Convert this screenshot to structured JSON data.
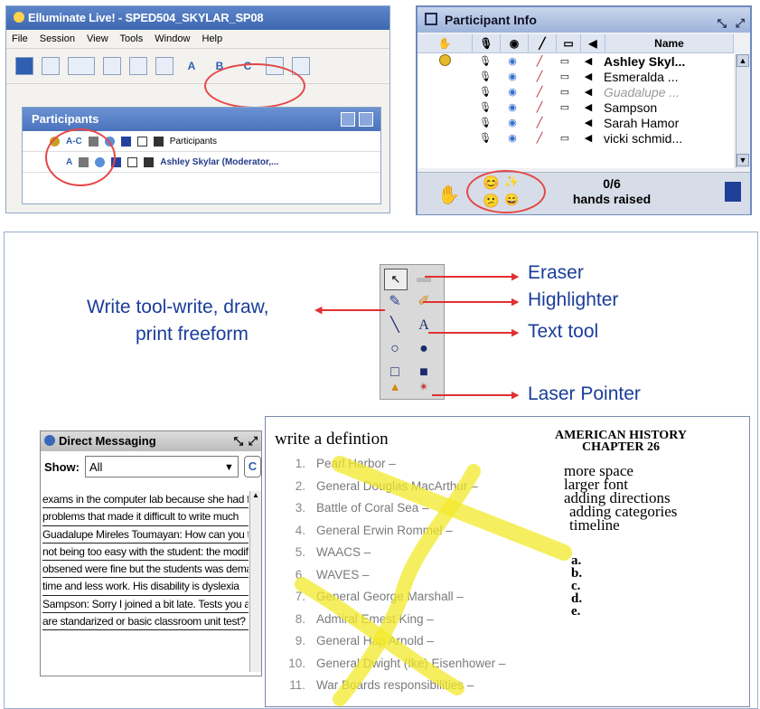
{
  "elluminate": {
    "title": "Elluminate Live! - SPED504_SKYLAR_SP08",
    "menu": [
      "File",
      "Session",
      "View",
      "Tools",
      "Window",
      "Help"
    ],
    "toolbar_letters": [
      "A",
      "B",
      "C"
    ]
  },
  "participants": {
    "title": "Participants",
    "header_label": "Participants",
    "row_name": "Ashley Skylar (Moderator,...",
    "ac_label": "A-C",
    "a_label": "A"
  },
  "participant_info": {
    "title": "Participant Info",
    "name_header": "Name",
    "rows": [
      {
        "name": "Ashley Skyl...",
        "style": "bold",
        "icons": [
          true,
          true,
          true,
          true
        ]
      },
      {
        "name": "Esmeralda ...",
        "style": "normal",
        "icons": [
          true,
          true,
          true,
          true
        ]
      },
      {
        "name": "Guadalupe ...",
        "style": "italic",
        "icons": [
          true,
          true,
          true,
          true
        ]
      },
      {
        "name": "Sampson",
        "style": "normal",
        "icons": [
          true,
          true,
          true,
          true
        ]
      },
      {
        "name": "Sarah Hamor",
        "style": "normal",
        "icons": [
          true,
          true,
          true,
          false
        ]
      },
      {
        "name": "vicki schmid...",
        "style": "normal",
        "icons": [
          true,
          true,
          true,
          true
        ]
      }
    ],
    "hands_count": "0/6",
    "hands_label": "hands raised"
  },
  "tools_legend": {
    "write_tool_label": "Write tool-write, draw,",
    "write_tool_label2": "print freeform",
    "eraser": "Eraser",
    "highlighter": "Highlighter",
    "text_tool": "Text tool",
    "laser_pointer": "Laser Pointer",
    "text_glyph": "A"
  },
  "direct_messaging": {
    "title": "Direct Messaging",
    "show_label": "Show:",
    "show_value": "All",
    "lines": [
      "exams in the computer lab because she had fine motor",
      "problems that made it difficult to write much",
      "Guadalupe Mireles Toumayan: How can you tell if you are",
      "not being too easy with the student: the modifications that I",
      "obsened were fine but the students was demanding more",
      "time and less work. His disability is dyslexia",
      "Sampson: Sorry I joined a bit late. Tests you are referring to",
      "are standarized or basic classroom unit test?"
    ]
  },
  "worksheet": {
    "heading": "write a defintion",
    "title_line1": "AMERICAN HISTORY",
    "title_line2": "CHAPTER 26",
    "items": [
      {
        "n": "1.",
        "text": "Pearl Harbor –"
      },
      {
        "n": "2.",
        "text": "General Douglas MacArthur –"
      },
      {
        "n": "3.",
        "text": "Battle of Coral Sea –"
      },
      {
        "n": "4.",
        "text": "General Erwin Rommel –"
      },
      {
        "n": "5.",
        "text": "WAACS –"
      },
      {
        "n": "6.",
        "text": "WAVES –"
      },
      {
        "n": "7.",
        "text": "General George Marshall –"
      },
      {
        "n": "8.",
        "text": "Admiral Emest King –"
      },
      {
        "n": "9.",
        "text": "General Hap Arnold –"
      },
      {
        "n": "10.",
        "text": "General Dwight (Ike) Eisenhower –"
      },
      {
        "n": "11.",
        "text": "War Boards responsibilities –"
      }
    ],
    "notes": [
      "more space",
      "larger font",
      "adding directions",
      "adding categories",
      "timeline"
    ],
    "letters": [
      "a.",
      "b.",
      "c.",
      "d.",
      "e."
    ]
  },
  "colors": {
    "annotation_red": "#e23030",
    "label_blue": "#1a3d9a",
    "highlight_yellow": "#f2ea2a"
  }
}
